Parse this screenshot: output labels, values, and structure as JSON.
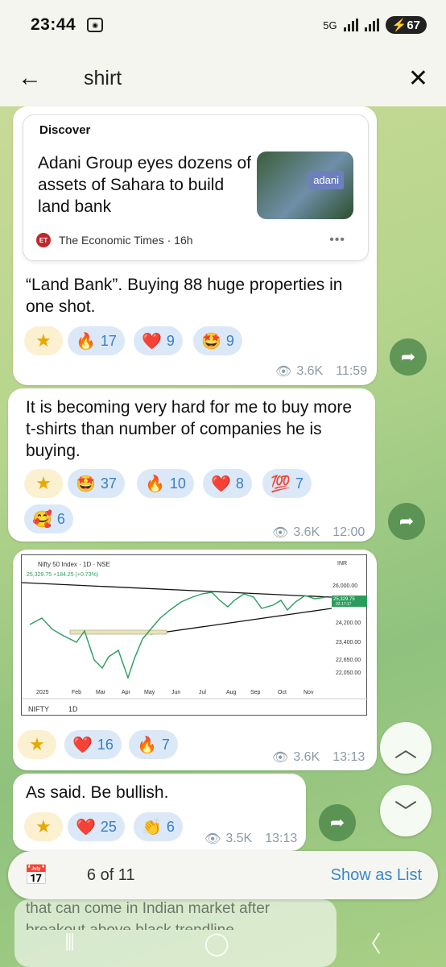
{
  "status": {
    "time": "23:44",
    "network": "5G",
    "battery": "67"
  },
  "search": {
    "query": "shirt"
  },
  "card": {
    "label": "Discover",
    "headline": "Adani Group eyes dozens of assets of Sahara to build land bank",
    "thumb_text": "adani",
    "source": "The Economic Times · 16h",
    "source_logo": "ET"
  },
  "messages": [
    {
      "text": "“Land Bank”. Buying 88 huge properties in one shot.",
      "reactions": [
        {
          "emoji": "🔥",
          "count": "17"
        },
        {
          "emoji": "❤️",
          "count": "9"
        },
        {
          "emoji": "🤩",
          "count": "9"
        }
      ],
      "views": "3.6K",
      "time": "11:59"
    },
    {
      "text": "It is becoming very hard for me to buy more t-shirts than number of companies he is buying.",
      "reactions": [
        {
          "emoji": "🤩",
          "count": "37"
        },
        {
          "emoji": "🔥",
          "count": "10"
        },
        {
          "emoji": "❤️",
          "count": "8"
        },
        {
          "emoji": "💯",
          "count": "7"
        },
        {
          "emoji": "🥰",
          "count": "6"
        }
      ],
      "views": "3.6K",
      "time": "12:00"
    },
    {
      "text": "",
      "reactions": [
        {
          "emoji": "❤️",
          "count": "16"
        },
        {
          "emoji": "🔥",
          "count": "7"
        }
      ],
      "views": "3.6K",
      "time": "13:13"
    },
    {
      "text": "As said. Be bullish.",
      "reactions": [
        {
          "emoji": "❤️",
          "count": "25"
        },
        {
          "emoji": "👏",
          "count": "6"
        }
      ],
      "views": "3.5K",
      "time": "13:13"
    }
  ],
  "chart_image": {
    "title": "Nifty 50 Index · 1D · NSE",
    "price_line": "25,329.75 +184.25 (+0.73%)",
    "currency": "INR",
    "last_price": "25,329.75",
    "timer": "02:17:17",
    "y_ticks": [
      "26,000.00",
      "24,200.00",
      "23,400.00",
      "22,650.00",
      "22,050.00"
    ],
    "x_ticks": [
      "2025",
      "Feb",
      "Mar",
      "Apr",
      "May",
      "Jun",
      "Jul",
      "Aug",
      "Sep",
      "Oct",
      "Nov"
    ],
    "toolbar": [
      "NIFTY",
      "1D"
    ]
  },
  "bottom": {
    "counter": "6 of 11",
    "show_list": "Show as List"
  },
  "ghost_text": "that can come in Indian market after breakout above black trendline"
}
